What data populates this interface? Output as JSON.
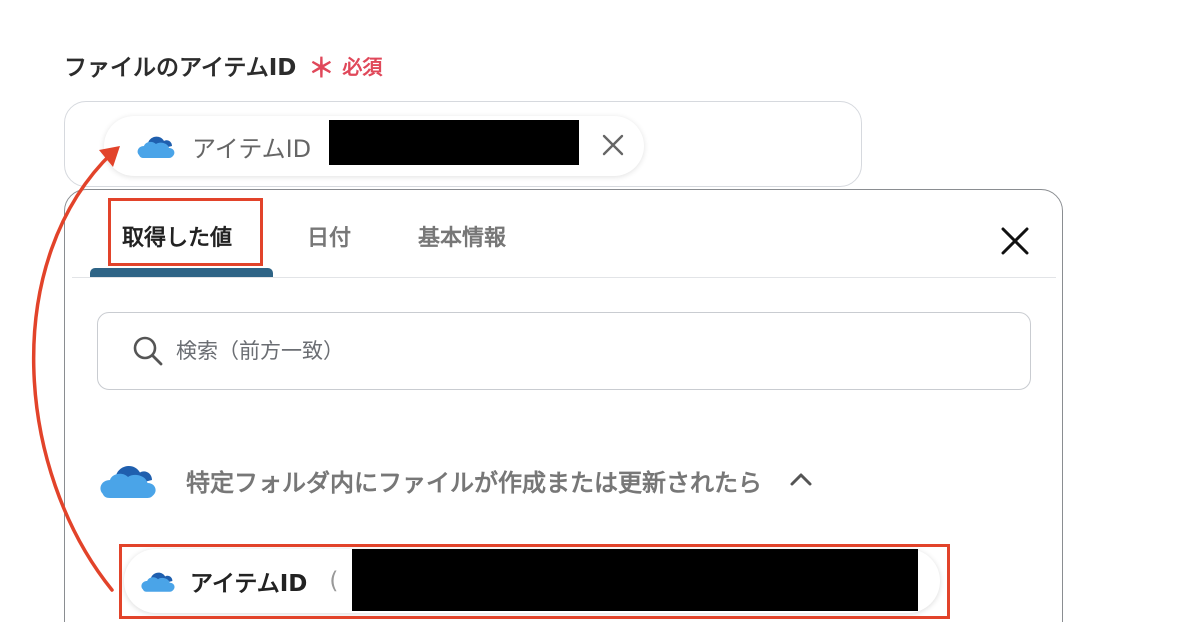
{
  "field": {
    "label": "ファイルのアイテムID",
    "required_mark": "＊",
    "required_text": "必須"
  },
  "selected_chip": {
    "label": "アイテムID",
    "icon": "onedrive-cloud-icon",
    "remove_icon": "close-icon"
  },
  "panel": {
    "tabs": [
      {
        "label": "取得した値",
        "active": true
      },
      {
        "label": "日付",
        "active": false
      },
      {
        "label": "基本情報",
        "active": false
      }
    ],
    "close_icon": "close-icon",
    "search": {
      "placeholder": "検索（前方一致）",
      "icon": "search-icon"
    },
    "group": {
      "title": "特定フォルダ内にファイルが作成または更新されたら",
      "icon": "onedrive-cloud-icon",
      "toggle_icon": "chevron-up-icon"
    },
    "items": [
      {
        "label": "アイテムID",
        "paren": "(",
        "icon": "onedrive-cloud-icon"
      }
    ]
  },
  "colors": {
    "required": "#e0485a",
    "annotation": "#e2432a",
    "tab_underline": "#2e6486",
    "cloud_dark": "#1f5fae",
    "cloud_light": "#4aa4e8"
  }
}
